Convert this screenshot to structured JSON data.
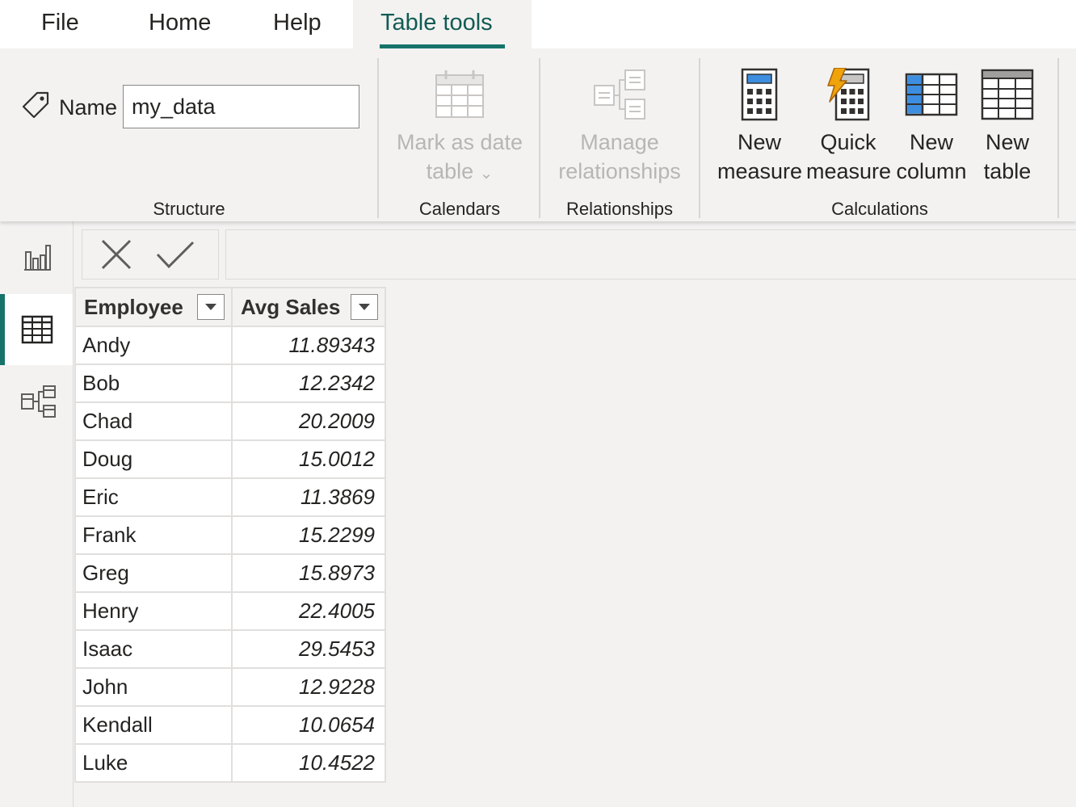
{
  "tabs": [
    {
      "id": "file",
      "label": "File"
    },
    {
      "id": "home",
      "label": "Home"
    },
    {
      "id": "help",
      "label": "Help"
    },
    {
      "id": "table-tools",
      "label": "Table tools",
      "active": true
    }
  ],
  "ribbon": {
    "structure": {
      "name_label": "Name",
      "name_value": "my_data",
      "group_label": "Structure"
    },
    "calendars": {
      "mark_as_date_line1": "Mark as date",
      "mark_as_date_line2": "table",
      "dropdown_glyph": "⌄",
      "group_label": "Calendars"
    },
    "relationships": {
      "manage_line1": "Manage",
      "manage_line2": "relationships",
      "group_label": "Relationships"
    },
    "calculations": {
      "new_measure_line1": "New",
      "new_measure_line2": "measure",
      "quick_measure_line1": "Quick",
      "quick_measure_line2": "measure",
      "new_column_line1": "New",
      "new_column_line2": "column",
      "new_table_line1": "New",
      "new_table_line2": "table",
      "group_label": "Calculations"
    }
  },
  "nav": [
    {
      "id": "report-view",
      "icon": "bar-chart-icon"
    },
    {
      "id": "data-view",
      "icon": "table-grid-icon",
      "active": true
    },
    {
      "id": "model-view",
      "icon": "model-diagram-icon"
    }
  ],
  "icons": {
    "name": "tag-icon",
    "mark_as_date": "calendar-icon",
    "manage_relationships": "relationships-icon",
    "new_measure": "calculator-icon",
    "quick_measure": "lightning-calculator-icon",
    "new_column": "column-highlight-icon",
    "new_table": "table-icon",
    "cancel": "close-icon",
    "commit": "check-icon"
  },
  "colors": {
    "accent": "#15736a",
    "active_tab_text": "#125b53",
    "disabled_text": "#b8b6b4",
    "icon_blue": "#3d8ee0",
    "icon_bolt": "#f0a30a"
  },
  "table": {
    "columns": [
      "Employee",
      "Avg Sales"
    ],
    "rows": [
      {
        "employee": "Andy",
        "avg_sales": "11.89343"
      },
      {
        "employee": "Bob",
        "avg_sales": "12.2342"
      },
      {
        "employee": "Chad",
        "avg_sales": "20.2009"
      },
      {
        "employee": "Doug",
        "avg_sales": "15.0012"
      },
      {
        "employee": "Eric",
        "avg_sales": "11.3869"
      },
      {
        "employee": "Frank",
        "avg_sales": "15.2299"
      },
      {
        "employee": "Greg",
        "avg_sales": "15.8973"
      },
      {
        "employee": "Henry",
        "avg_sales": "22.4005"
      },
      {
        "employee": "Isaac",
        "avg_sales": "29.5453"
      },
      {
        "employee": "John",
        "avg_sales": "12.9228"
      },
      {
        "employee": "Kendall",
        "avg_sales": "10.0654"
      },
      {
        "employee": "Luke",
        "avg_sales": "10.4522"
      }
    ]
  }
}
